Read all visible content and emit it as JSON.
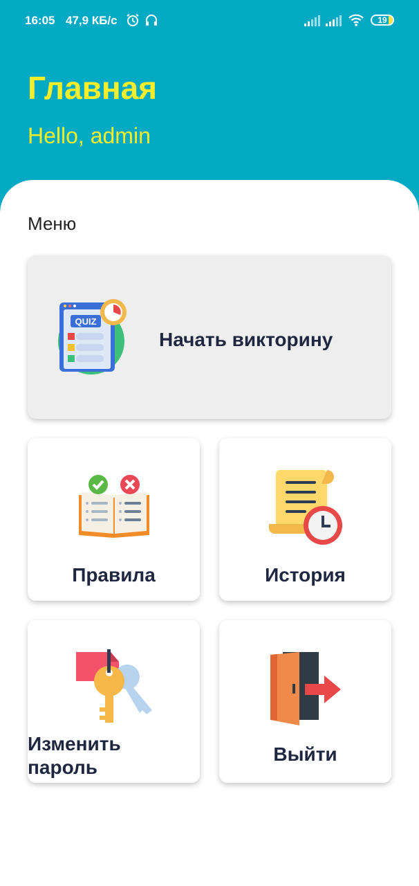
{
  "status_bar": {
    "time": "16:05",
    "speed": "47,9 КБ/с",
    "battery": "19",
    "icons": [
      "alarm-icon",
      "headphones-icon",
      "signal-icon",
      "signal-icon",
      "wifi-icon",
      "battery-icon"
    ]
  },
  "header": {
    "title": "Главная",
    "greeting": "Hello, admin",
    "background": "#04a9c4",
    "text_color": "#f5ee2a"
  },
  "menu": {
    "label": "Меню",
    "items": [
      {
        "label": "Начать викторину",
        "icon": "quiz-icon",
        "badge": "QUIZ"
      },
      {
        "label": "Правила",
        "icon": "rules-book-icon"
      },
      {
        "label": "История",
        "icon": "history-scroll-icon"
      },
      {
        "label": "Изменить\nпароль",
        "icon": "keys-icon"
      },
      {
        "label": "Выйти",
        "icon": "exit-door-icon"
      }
    ]
  }
}
